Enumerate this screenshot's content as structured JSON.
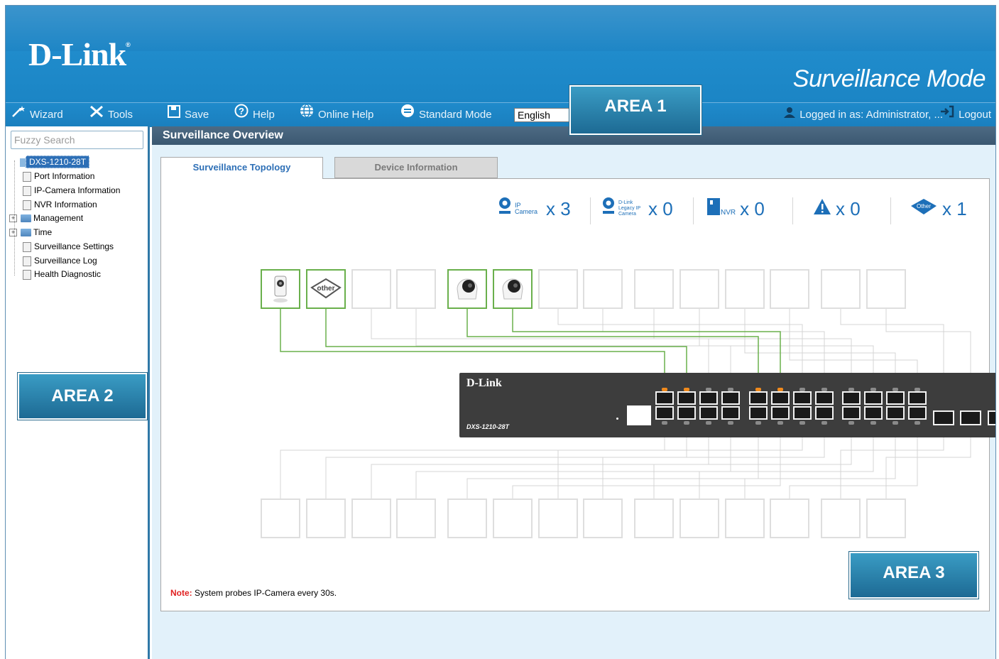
{
  "banner": {
    "logo": "D-Link",
    "mode_title": "Surveillance Mode"
  },
  "toolbar": {
    "wizard": "Wizard",
    "tools": "Tools",
    "save": "Save",
    "help": "Help",
    "online_help": "Online Help",
    "standard_mode": "Standard Mode",
    "language": "English",
    "logged_in": "Logged in as:  Administrator, ...",
    "logout": "Logout"
  },
  "area_labels": {
    "area1": "AREA 1",
    "area2": "AREA 2",
    "area3": "AREA 3"
  },
  "sidebar": {
    "search_placeholder": "Fuzzy Search",
    "items": [
      {
        "label": "DXS-1210-28T",
        "type": "device",
        "selected": true
      },
      {
        "label": "Port Information",
        "type": "doc"
      },
      {
        "label": "IP-Camera Information",
        "type": "doc"
      },
      {
        "label": "NVR Information",
        "type": "doc"
      },
      {
        "label": "Management",
        "type": "folder"
      },
      {
        "label": "Time",
        "type": "folder"
      },
      {
        "label": "Surveillance Settings",
        "type": "doc"
      },
      {
        "label": "Surveillance Log",
        "type": "doc"
      },
      {
        "label": "Health Diagnostic",
        "type": "doc"
      }
    ]
  },
  "main": {
    "title": "Surveillance Overview",
    "tabs": [
      {
        "label": "Surveillance Topology",
        "active": true
      },
      {
        "label": "Device Information",
        "active": false
      }
    ],
    "stats": [
      {
        "icon": "ip-camera-icon",
        "label": "IP Camera",
        "count": "x 3"
      },
      {
        "icon": "legacy-camera-icon",
        "label": "D-Link Legacy IP Camera",
        "count": "x 0"
      },
      {
        "icon": "nvr-icon",
        "label": "NVR",
        "count": "x 0"
      },
      {
        "icon": "warning-icon",
        "label": "",
        "count": "x 0"
      },
      {
        "icon": "other-icon",
        "label": "Other",
        "count": "x 1"
      }
    ],
    "switch": {
      "brand": "D-Link",
      "model": "DXS-1210-28T"
    },
    "note_label": "Note:",
    "note_text": " System probes IP-Camera every 30s."
  },
  "colors": {
    "accent": "#1e86c6",
    "active_device": "#6ab04c",
    "port_active_led": "#f08a1c"
  }
}
